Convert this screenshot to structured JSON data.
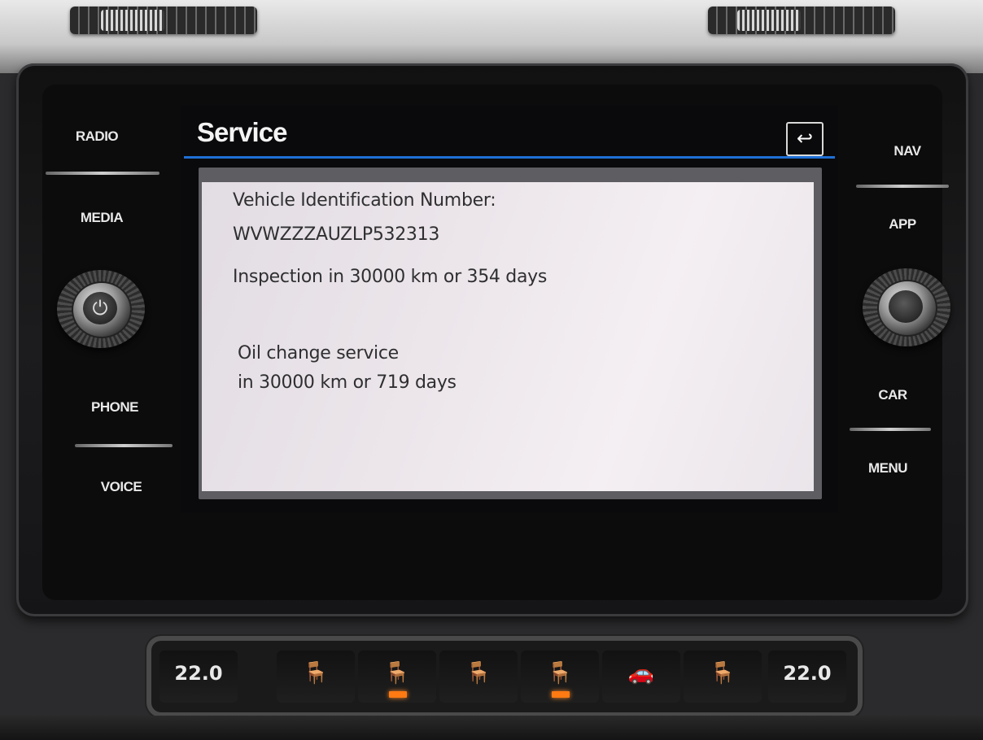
{
  "unit_buttons": {
    "radio": "RADIO",
    "media": "MEDIA",
    "phone": "PHONE",
    "voice": "VOICE",
    "nav": "NAV",
    "app": "APP",
    "car": "CAR",
    "menu": "MENU"
  },
  "screen": {
    "title": "Service",
    "back_icon": "back-arrow-icon",
    "lines": {
      "vin_label": "Vehicle Identification Number:",
      "vin_value": "WVWZZZAUZLP532313",
      "inspection": "Inspection in 30000 km or 354 days",
      "oil_line1": "Oil change service",
      "oil_line2": "in 30000 km or 719 days"
    }
  },
  "climate": {
    "left_temp": "22.0",
    "right_temp": "22.0",
    "led_color": "#ff7a12"
  },
  "colors": {
    "accent_line": "#1f6fd6",
    "screen_bg": "#ece6eb"
  }
}
